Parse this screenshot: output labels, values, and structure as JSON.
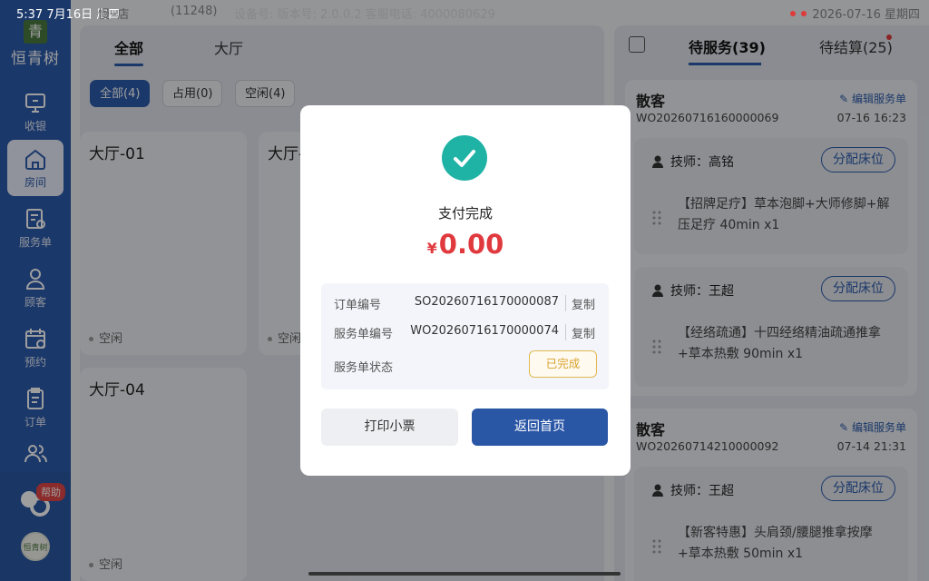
{
  "statusbar": {
    "time": "5:37",
    "date": "7月16日 周四",
    "store": "慢··店",
    "count": "(11248)",
    "device": "设备号: 版本号: 2.0.0.2 客服电话: 4000080629",
    "right_date": "2026-07-16 星期四"
  },
  "sidebar": {
    "logo_mark": "青",
    "logo_text": "恒青树",
    "items": [
      {
        "label": "收银",
        "icon": "monitor-icon"
      },
      {
        "label": "房间",
        "icon": "home-icon"
      },
      {
        "label": "服务单",
        "icon": "service-order-icon"
      },
      {
        "label": "顾客",
        "icon": "customer-icon"
      },
      {
        "label": "预约",
        "icon": "calendar-icon"
      },
      {
        "label": "订单",
        "icon": "order-icon"
      },
      {
        "label": "",
        "icon": "staff-icon"
      }
    ],
    "help_badge": "帮助",
    "avatar_text": "恒青树"
  },
  "main": {
    "tabs": [
      "全部",
      "大厅"
    ],
    "filters": [
      "全部(4)",
      "占用(0)",
      "空闲(4)"
    ],
    "rooms": [
      {
        "name": "大厅-01",
        "status": "空闲"
      },
      {
        "name": "大厅-02",
        "status": "空闲"
      },
      {
        "name": "大厅-04",
        "status": ""
      },
      {
        "name": "",
        "status": "空闲"
      }
    ]
  },
  "right_panel": {
    "tabs": [
      "待服务(39)",
      "待结算(25)"
    ],
    "orders": [
      {
        "customer": "散客",
        "edit_label": "编辑服务单",
        "order_no": "WO20260716160000069",
        "time": "07-16 16:23",
        "services": [
          {
            "tech": "技师：高铭",
            "assign": "分配床位",
            "item": "【招牌足疗】草本泡脚+大师修脚+解压足疗 40min x1"
          },
          {
            "tech": "技师：王超",
            "assign": "分配床位",
            "item": "【经络疏通】十四经络精油疏通推拿+草本热敷 90min x1"
          }
        ]
      },
      {
        "customer": "散客",
        "edit_label": "编辑服务单",
        "order_no": "WO20260714210000092",
        "time": "07-14 21:31",
        "services": [
          {
            "tech": "技师：王超",
            "assign": "分配床位",
            "item": "【新客特惠】头肩颈/腰腿推拿按摩+草本热敷 50min x1"
          }
        ]
      }
    ]
  },
  "dialog": {
    "title": "支付完成",
    "currency": "¥",
    "amount": "0.00",
    "rows": [
      {
        "label": "订单编号",
        "value": "SO20260716170000087",
        "action": "复制"
      },
      {
        "label": "服务单编号",
        "value": "WO20260716170000074",
        "action": "复制"
      },
      {
        "label": "服务单状态",
        "value": "已完成"
      }
    ],
    "print_label": "打印小票",
    "home_label": "返回首页"
  },
  "colors": {
    "primary": "#2c5bab",
    "success": "#1fb3a6",
    "amount": "#e0393e",
    "status_done": "#d9a22b"
  }
}
